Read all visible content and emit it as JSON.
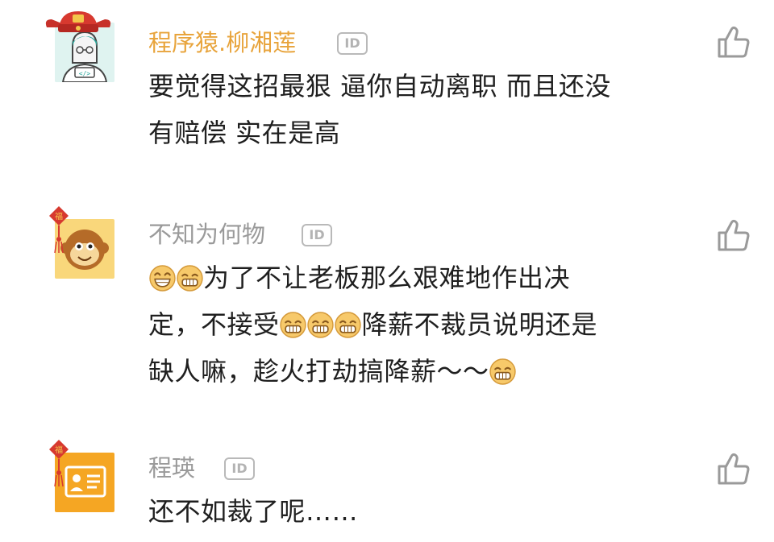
{
  "colors": {
    "vip_name": "#e8a43c",
    "normal_name": "#9a9a9a",
    "text": "#1f1f1f",
    "like_icon": "#9a9a9a"
  },
  "id_badge_label": "ID",
  "comments": [
    {
      "username": "程序猿.柳湘莲",
      "avatar_icon": "programmer-avatar-icon",
      "content": [
        "要觉得这招最狠 逼你自动离职 而且还没",
        "有赔偿 实在是高"
      ]
    },
    {
      "username": "不知为何物",
      "avatar_icon": "monkey-avatar-icon",
      "content_parts": {
        "line1_text": "为了不让老板那么艰难地作出决",
        "line2_a": "定，不接受",
        "line2_b": "降薪不裁员说明还是",
        "line3_text": "缺人嘛，趁火打劫搞降薪～～"
      }
    },
    {
      "username": "程瑛",
      "avatar_icon": "id-card-avatar-icon",
      "content": [
        "还不如裁了呢……"
      ]
    }
  ]
}
